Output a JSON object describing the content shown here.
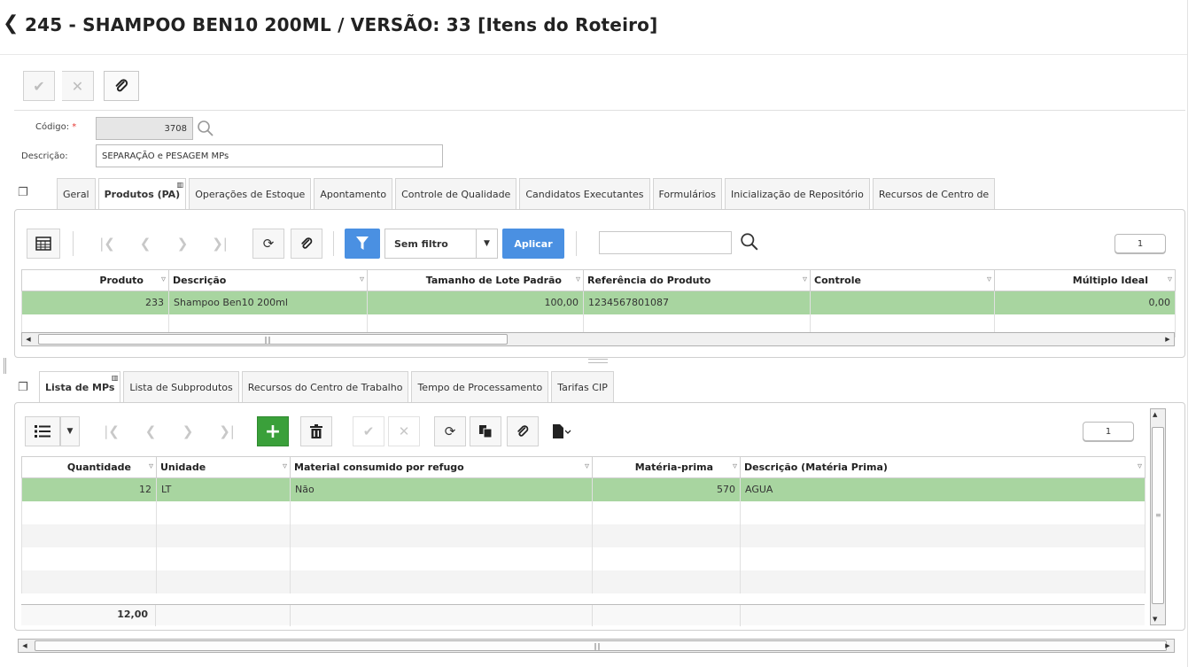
{
  "header": {
    "back_label": "‹",
    "title": "245 - SHAMPOO BEN10 200ML / VERSÃO: 33 [Itens do Roteiro]"
  },
  "toolbar": {
    "confirm_icon": "✔",
    "cancel_icon": "✕",
    "attach_icon": "paperclip-icon"
  },
  "form": {
    "codigo_label": "Código:",
    "codigo_required": "*",
    "codigo_value": "3708",
    "descricao_label": "Descrição:",
    "descricao_value": "SEPARAÇÃO e PESAGEM MPs"
  },
  "top_tabs": [
    {
      "label": "Geral"
    },
    {
      "label": "Produtos (PA)",
      "selected": true
    },
    {
      "label": "Operações de Estoque"
    },
    {
      "label": "Apontamento"
    },
    {
      "label": "Controle de Qualidade"
    },
    {
      "label": "Candidatos Executantes"
    },
    {
      "label": "Formulários"
    },
    {
      "label": "Inicialização de Repositório"
    },
    {
      "label": "Recursos de Centro de"
    }
  ],
  "produtos_grid": {
    "filter_select": "Sem filtro",
    "apply_label": "Aplicar",
    "search_value": "",
    "page": "1",
    "columns": [
      "Produto",
      "Descrição",
      "Tamanho de Lote Padrão",
      "Referência do Produto",
      "Controle",
      "Múltiplo Ideal"
    ],
    "rows": [
      [
        "233",
        "Shampoo Ben10 200ml",
        "100,00",
        "1234567801087",
        "",
        "0,00"
      ]
    ]
  },
  "bottom_tabs": [
    {
      "label": "Lista de MPs",
      "selected": true
    },
    {
      "label": "Lista de Subprodutos"
    },
    {
      "label": "Recursos do Centro de Trabalho"
    },
    {
      "label": "Tempo de Processamento"
    },
    {
      "label": "Tarifas CIP"
    }
  ],
  "mps_grid": {
    "page": "1",
    "columns": [
      "Quantidade",
      "Unidade",
      "Material consumido por refugo",
      "Matéria-prima",
      "Descrição (Matéria Prima)"
    ],
    "rows": [
      [
        "12",
        "LT",
        "Não",
        "570",
        "AGUA"
      ]
    ],
    "total_quantidade": "12,00"
  },
  "colors": {
    "selected_row": "#a8d5a0",
    "accent_blue": "#4a90e2",
    "add_green": "#3aa03a"
  }
}
